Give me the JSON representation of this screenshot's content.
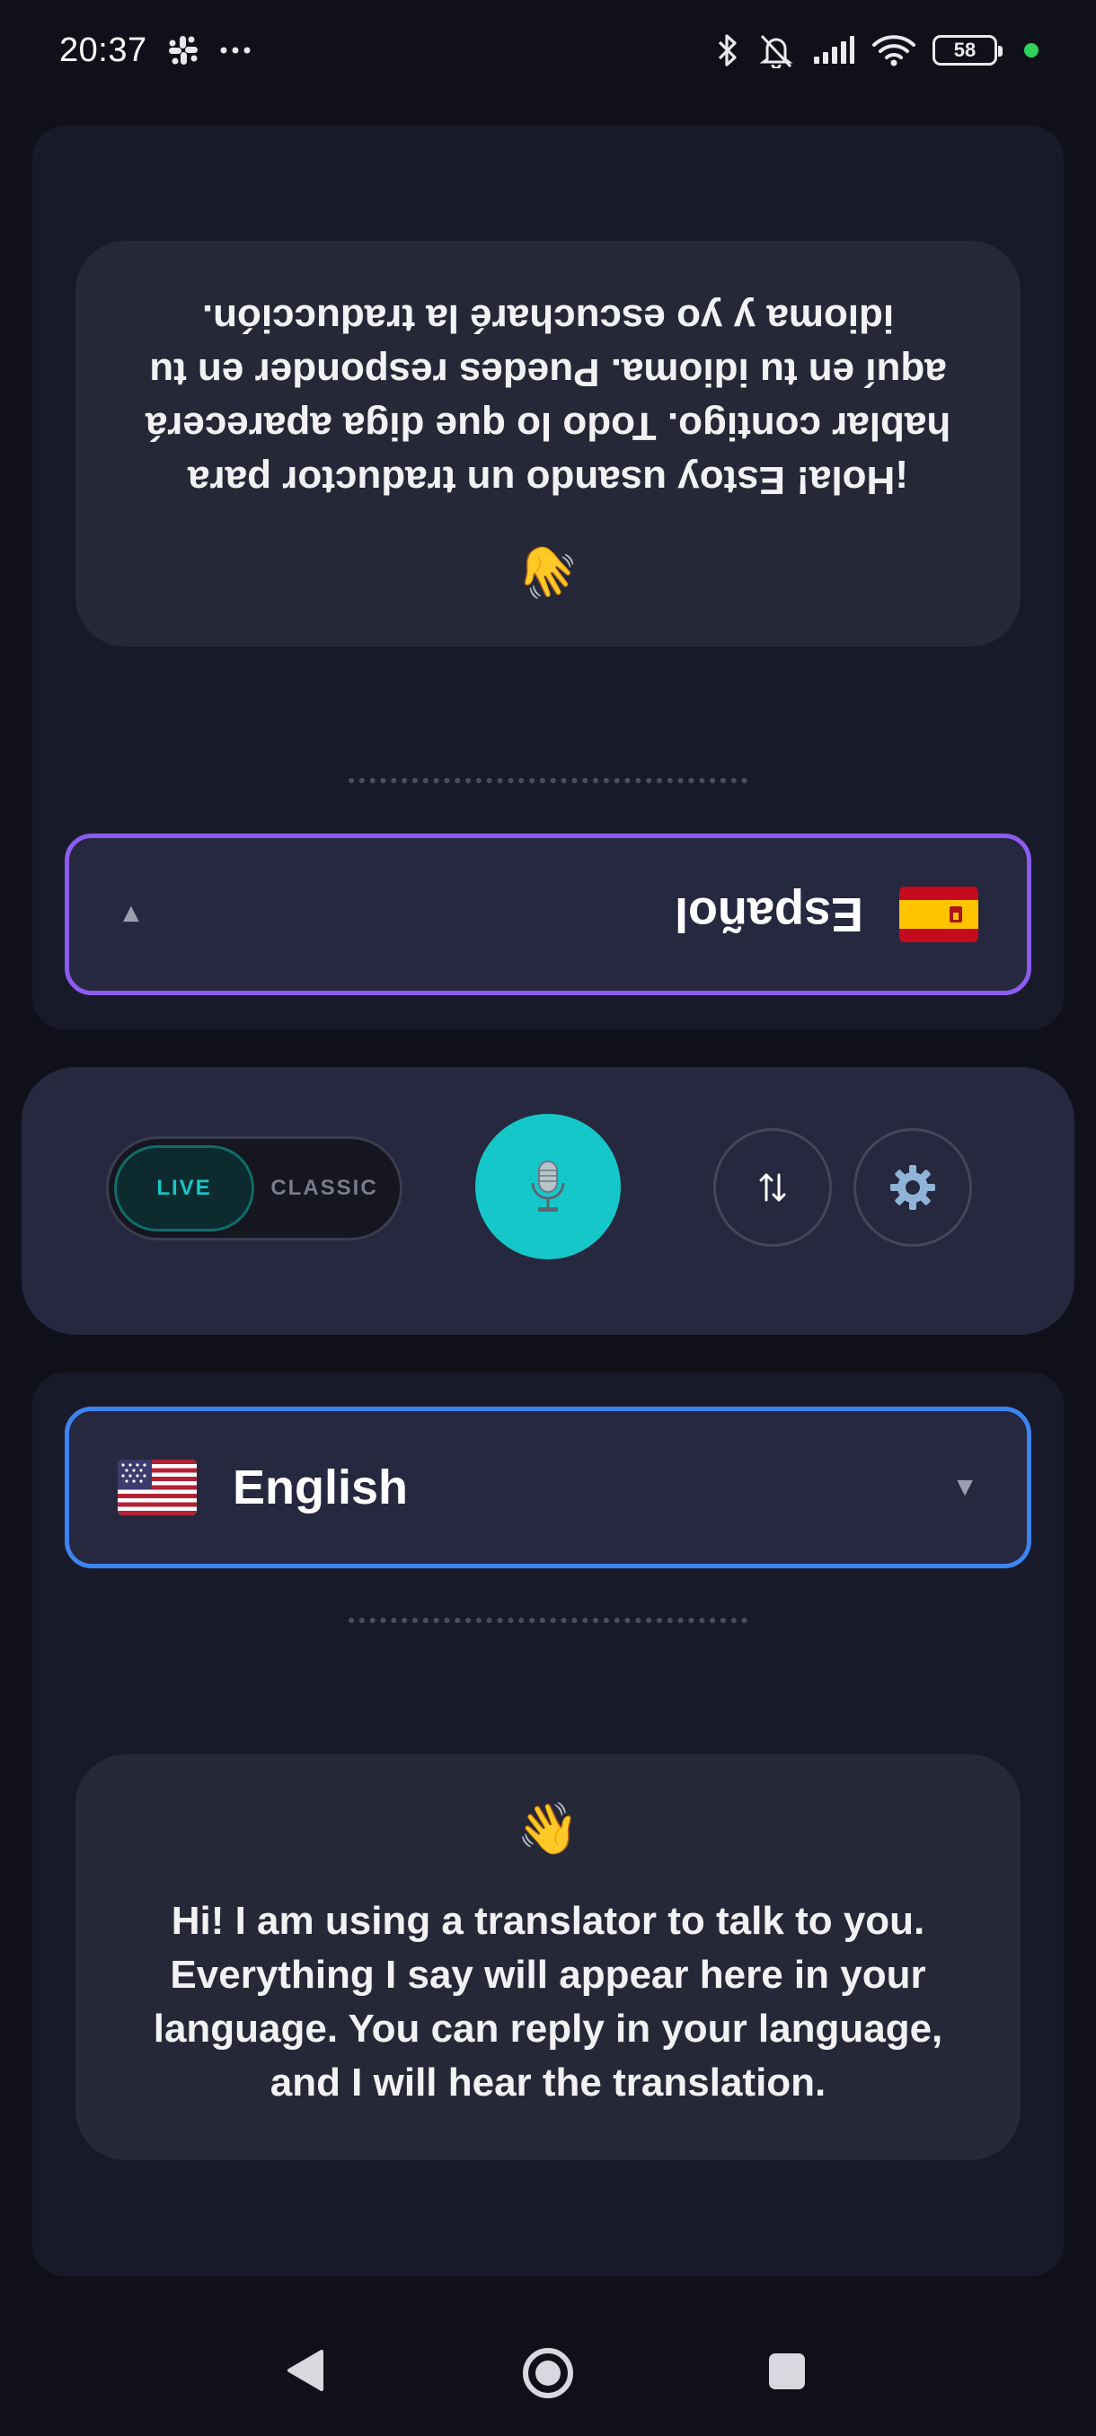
{
  "status_bar": {
    "time": "20:37",
    "battery_level": "58",
    "icons": [
      "slack-icon",
      "more-dots-icon",
      "bluetooth-icon",
      "bell-muted-icon",
      "signal-icon",
      "wifi-icon",
      "battery-icon",
      "active-dot-icon"
    ]
  },
  "top_panel": {
    "message": "¡Hola! Estoy usando un traductor para hablar contigo. Todo lo que diga aparecerá aquí en tu idioma. Puedes responder en tu idioma y yo escucharé la traducción.",
    "wave_emoji": "👋",
    "language": "Español",
    "flag": "spain-flag",
    "caret": "▼"
  },
  "controls": {
    "mode_live": "LIVE",
    "mode_classic": "CLASSIC",
    "mic_emoji": "🎙️",
    "swap_glyph": "⇅",
    "settings_emoji": "⚙️"
  },
  "bottom_panel": {
    "language": "English",
    "flag": "us-flag",
    "caret": "▼",
    "wave_emoji": "👋",
    "message": "Hi! I am using a translator to talk to you. Everything I say will appear here in your language. You can reply in your language, and I will hear the translation."
  },
  "colors": {
    "background": "#0f1019",
    "panel": "#181a2a",
    "bubble": "#262837",
    "accent_teal": "#15c7c9",
    "border_purple": "#8c5cf0",
    "border_blue": "#3d84f2"
  }
}
